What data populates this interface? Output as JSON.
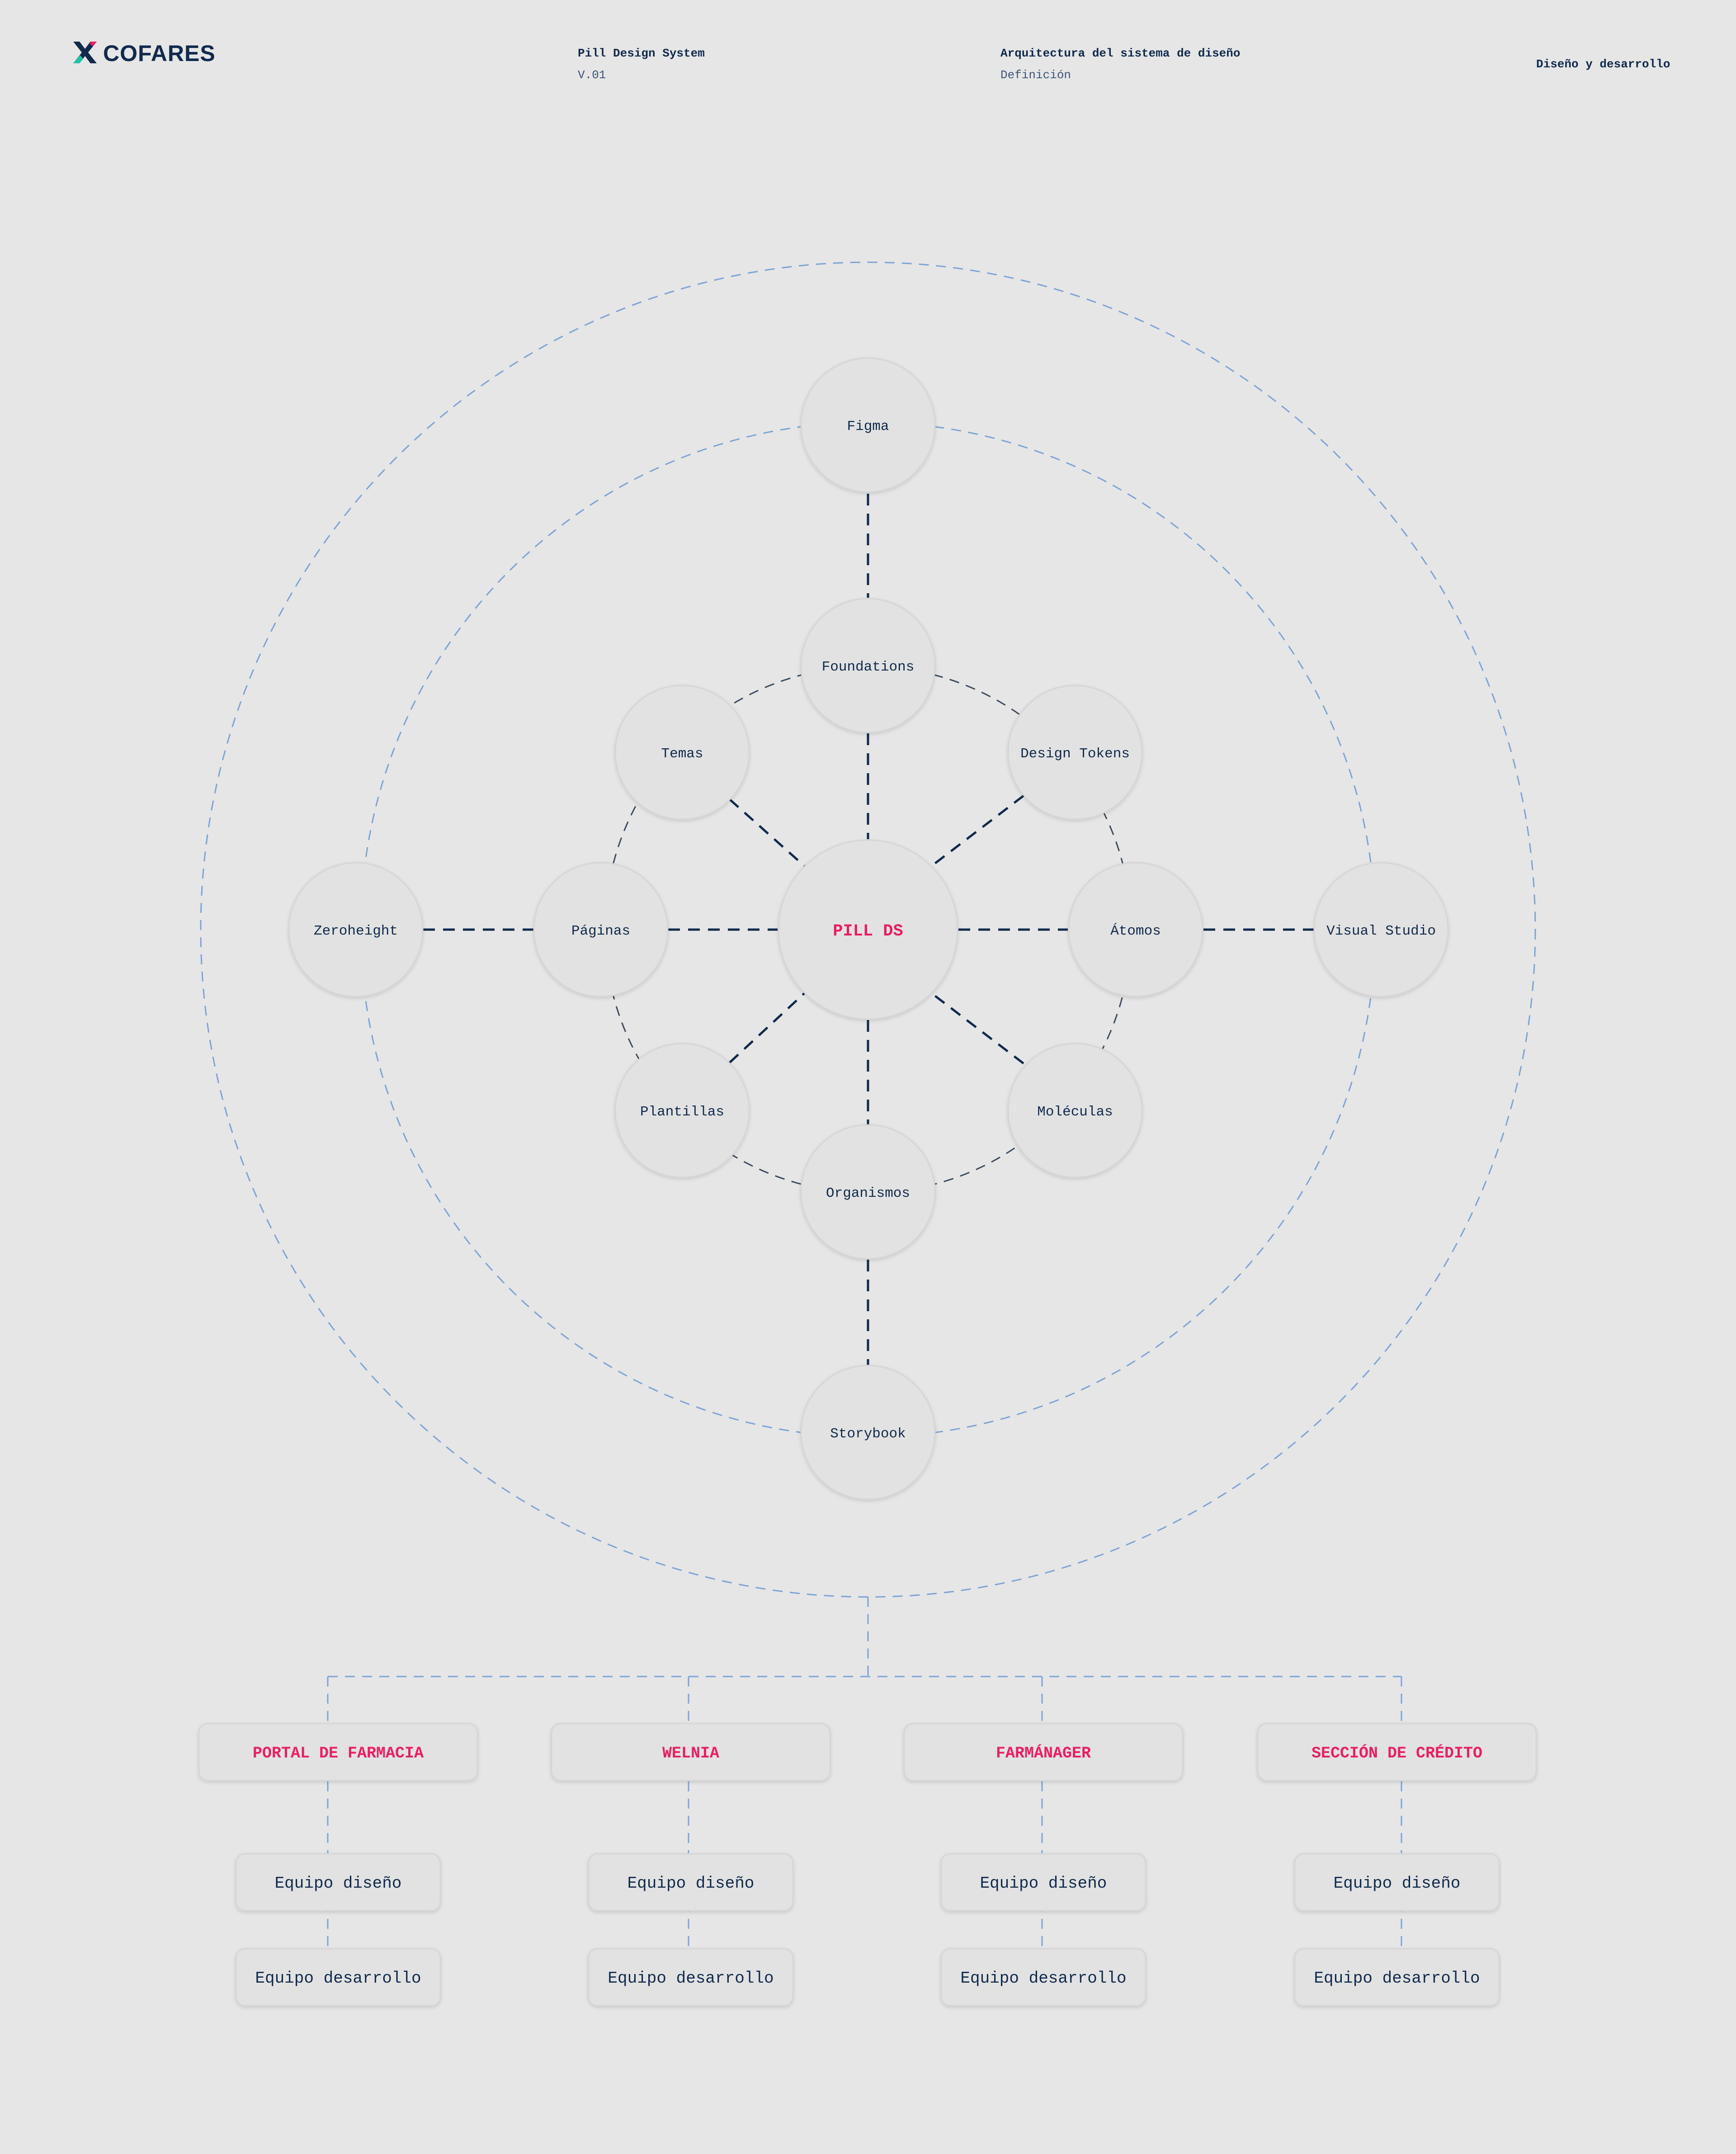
{
  "header": {
    "brand": "COFARES",
    "project_title": "Pill Design System",
    "version": "V.01",
    "doc_title": "Arquitectura del sistema de diseño",
    "doc_subtitle": "Definición",
    "section": "Diseño y desarrollo"
  },
  "diagram": {
    "center": "PILL DS",
    "inner_nodes": {
      "foundations": "Foundations",
      "design_tokens": "Design Tokens",
      "atomos": "Átomos",
      "moleculas": "Moléculas",
      "organismos": "Organismos",
      "plantillas": "Plantillas",
      "paginas": "Páginas",
      "temas": "Temas"
    },
    "outer_nodes": {
      "figma": "Figma",
      "visual_studio": "Visual Studio",
      "storybook": "Storybook",
      "zeroheight": "Zeroheight"
    }
  },
  "projects": [
    {
      "name": "PORTAL DE FARMACIA",
      "teams": [
        "Equipo diseño",
        "Equipo desarrollo"
      ]
    },
    {
      "name": "WELNIA",
      "teams": [
        "Equipo diseño",
        "Equipo desarrollo"
      ]
    },
    {
      "name": "FARMÁNAGER",
      "teams": [
        "Equipo diseño",
        "Equipo desarrollo"
      ]
    },
    {
      "name": "SECCIÓN DE CRÉDITO",
      "teams": [
        "Equipo diseño",
        "Equipo desarrollo"
      ]
    }
  ],
  "colors": {
    "background": "#e6e6e6",
    "node_fill": "#e2e2e2",
    "navy": "#102a4c",
    "accent_pink": "#e91e63",
    "ring_blue": "#7da3d6",
    "logo_teal": "#1fc3a8"
  }
}
